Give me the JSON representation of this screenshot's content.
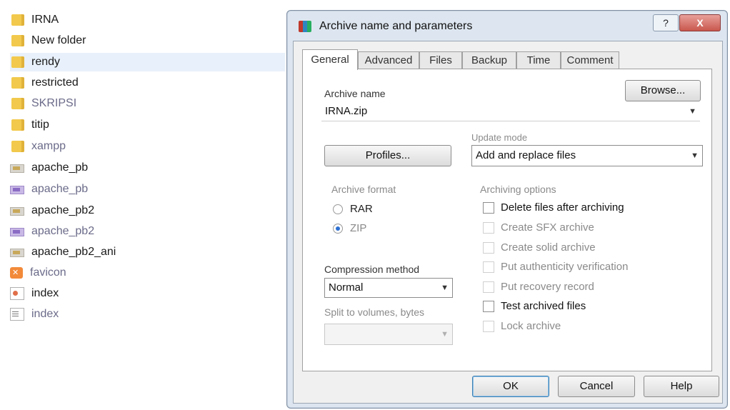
{
  "explorer": {
    "files": [
      {
        "name": "IRNA",
        "icon": "folder-icon"
      },
      {
        "name": "New folder",
        "icon": "folder-icon"
      },
      {
        "name": "rendy",
        "icon": "folder-icon",
        "selected": true
      },
      {
        "name": "restricted",
        "icon": "folder-icon"
      },
      {
        "name": "SKRIPSI",
        "icon": "folder-icon"
      },
      {
        "name": "titip",
        "icon": "folder-icon"
      },
      {
        "name": "xampp",
        "icon": "folder-icon"
      },
      {
        "name": "apache_pb",
        "icon": "gif-file-icon"
      },
      {
        "name": "apache_pb",
        "icon": "png-file-icon"
      },
      {
        "name": "apache_pb2",
        "icon": "gif-file-icon"
      },
      {
        "name": "apache_pb2",
        "icon": "png-file-icon"
      },
      {
        "name": "apache_pb2_ani",
        "icon": "gif-file-icon"
      },
      {
        "name": "favicon",
        "icon": "xampp-icon"
      },
      {
        "name": "index",
        "icon": "html-file-icon"
      },
      {
        "name": "index",
        "icon": "text-file-icon"
      }
    ]
  },
  "dialog": {
    "title": "Archive name and parameters",
    "help_label": "?",
    "close_label": "X",
    "tabs": [
      "General",
      "Advanced",
      "Files",
      "Backup",
      "Time",
      "Comment"
    ],
    "active_tab": "General",
    "archive_name_label": "Archive name",
    "archive_name_value": "IRNA.zip",
    "browse_label": "Browse...",
    "update_mode_label": "Update mode",
    "update_mode_value": "Add and replace files",
    "profiles_label": "Profiles...",
    "archive_format_label": "Archive format",
    "format_options": [
      {
        "label": "RAR",
        "selected": false
      },
      {
        "label": "ZIP",
        "selected": true
      }
    ],
    "archiving_options_label": "Archiving options",
    "archiving_options": [
      {
        "label": "Delete files after archiving",
        "checked": false,
        "enabled": true
      },
      {
        "label": "Create SFX archive",
        "checked": false,
        "enabled": false
      },
      {
        "label": "Create solid archive",
        "checked": false,
        "enabled": false
      },
      {
        "label": "Put authenticity verification",
        "checked": false,
        "enabled": false
      },
      {
        "label": "Put recovery record",
        "checked": false,
        "enabled": false
      },
      {
        "label": "Test archived files",
        "checked": false,
        "enabled": true
      },
      {
        "label": "Lock archive",
        "checked": false,
        "enabled": false
      }
    ],
    "compression_method_label": "Compression method",
    "compression_method_value": "Normal",
    "split_volumes_label": "Split to volumes, bytes",
    "split_volumes_value": "",
    "ok_label": "OK",
    "cancel_label": "Cancel",
    "help_button_label": "Help"
  },
  "colors": {
    "dialog_frame": "#dde6f0",
    "selection": "#e8f1fb",
    "radio_dot": "#2c6fd1",
    "close_button": "#c9574d"
  }
}
